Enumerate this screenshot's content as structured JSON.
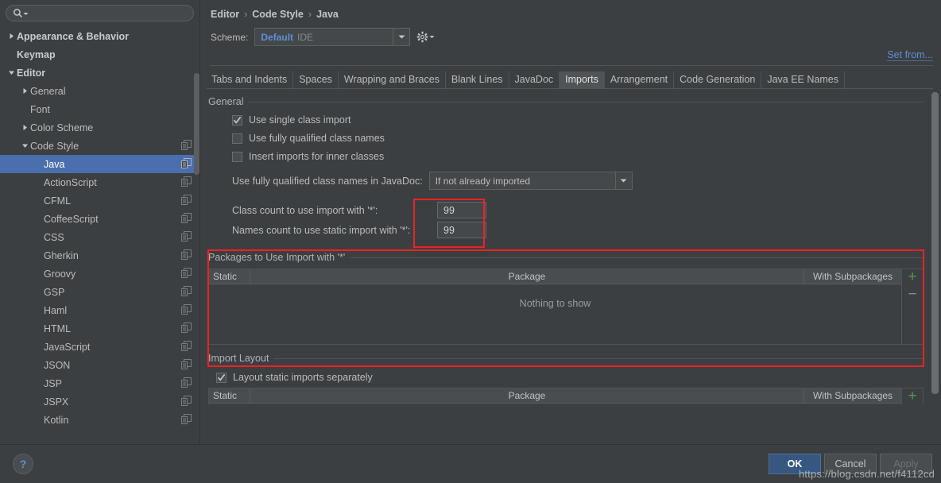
{
  "search": {
    "placeholder": "",
    "value": "",
    "icon": "search-icon"
  },
  "sidebar": {
    "items": [
      {
        "label": "Appearance & Behavior",
        "arrow": "collapsed",
        "indent": 0,
        "bold": true,
        "copy": false,
        "selected": false
      },
      {
        "label": "Keymap",
        "arrow": "none",
        "indent": 0,
        "bold": true,
        "copy": false,
        "selected": false
      },
      {
        "label": "Editor",
        "arrow": "expanded",
        "indent": 0,
        "bold": true,
        "copy": false,
        "selected": false
      },
      {
        "label": "General",
        "arrow": "collapsed",
        "indent": 1,
        "bold": false,
        "copy": false,
        "selected": false
      },
      {
        "label": "Font",
        "arrow": "none",
        "indent": 1,
        "bold": false,
        "copy": false,
        "selected": false
      },
      {
        "label": "Color Scheme",
        "arrow": "collapsed",
        "indent": 1,
        "bold": false,
        "copy": false,
        "selected": false
      },
      {
        "label": "Code Style",
        "arrow": "expanded",
        "indent": 1,
        "bold": false,
        "copy": true,
        "selected": false
      },
      {
        "label": "Java",
        "arrow": "none",
        "indent": 2,
        "bold": false,
        "copy": true,
        "selected": true
      },
      {
        "label": "ActionScript",
        "arrow": "none",
        "indent": 2,
        "bold": false,
        "copy": true,
        "selected": false
      },
      {
        "label": "CFML",
        "arrow": "none",
        "indent": 2,
        "bold": false,
        "copy": true,
        "selected": false
      },
      {
        "label": "CoffeeScript",
        "arrow": "none",
        "indent": 2,
        "bold": false,
        "copy": true,
        "selected": false
      },
      {
        "label": "CSS",
        "arrow": "none",
        "indent": 2,
        "bold": false,
        "copy": true,
        "selected": false
      },
      {
        "label": "Gherkin",
        "arrow": "none",
        "indent": 2,
        "bold": false,
        "copy": true,
        "selected": false
      },
      {
        "label": "Groovy",
        "arrow": "none",
        "indent": 2,
        "bold": false,
        "copy": true,
        "selected": false
      },
      {
        "label": "GSP",
        "arrow": "none",
        "indent": 2,
        "bold": false,
        "copy": true,
        "selected": false
      },
      {
        "label": "Haml",
        "arrow": "none",
        "indent": 2,
        "bold": false,
        "copy": true,
        "selected": false
      },
      {
        "label": "HTML",
        "arrow": "none",
        "indent": 2,
        "bold": false,
        "copy": true,
        "selected": false
      },
      {
        "label": "JavaScript",
        "arrow": "none",
        "indent": 2,
        "bold": false,
        "copy": true,
        "selected": false
      },
      {
        "label": "JSON",
        "arrow": "none",
        "indent": 2,
        "bold": false,
        "copy": true,
        "selected": false
      },
      {
        "label": "JSP",
        "arrow": "none",
        "indent": 2,
        "bold": false,
        "copy": true,
        "selected": false
      },
      {
        "label": "JSPX",
        "arrow": "none",
        "indent": 2,
        "bold": false,
        "copy": true,
        "selected": false
      },
      {
        "label": "Kotlin",
        "arrow": "none",
        "indent": 2,
        "bold": false,
        "copy": true,
        "selected": false
      }
    ]
  },
  "breadcrumb": {
    "parts": [
      "Editor",
      "Code Style",
      "Java"
    ],
    "separator": "›"
  },
  "scheme": {
    "label": "Scheme:",
    "value": "Default",
    "suffix": "IDE",
    "gear_icon": "gear-icon",
    "dropdown_icon": "chevron-down-icon"
  },
  "set_from": {
    "label": "Set from..."
  },
  "tabs": [
    {
      "label": "Tabs and Indents",
      "active": false
    },
    {
      "label": "Spaces",
      "active": false
    },
    {
      "label": "Wrapping and Braces",
      "active": false
    },
    {
      "label": "Blank Lines",
      "active": false
    },
    {
      "label": "JavaDoc",
      "active": false
    },
    {
      "label": "Imports",
      "active": true
    },
    {
      "label": "Arrangement",
      "active": false
    },
    {
      "label": "Code Generation",
      "active": false
    },
    {
      "label": "Java EE Names",
      "active": false
    }
  ],
  "general_group": {
    "title": "General",
    "checkboxes": [
      {
        "label": "Use single class import",
        "checked": true
      },
      {
        "label": "Use fully qualified class names",
        "checked": false
      },
      {
        "label": "Insert imports for inner classes",
        "checked": false
      }
    ],
    "javadoc": {
      "label": "Use fully qualified class names in JavaDoc:",
      "value": "If not already imported"
    },
    "class_count": {
      "label": "Class count to use import with '*':",
      "value": "99"
    },
    "names_count": {
      "label": "Names count to use static import with '*':",
      "value": "99"
    }
  },
  "packages_group": {
    "title": "Packages to Use Import with '*'",
    "columns": [
      "Static",
      "Package",
      "With Subpackages"
    ],
    "empty_text": "Nothing to show",
    "rows": [],
    "add_button": "+",
    "remove_button": "−"
  },
  "import_layout": {
    "title": "Import Layout",
    "checkbox": {
      "label": "Layout static imports separately",
      "checked": true
    },
    "columns": [
      "Static",
      "Package",
      "With Subpackages"
    ],
    "add_button": "+"
  },
  "footer": {
    "help_label": "?",
    "ok_label": "OK",
    "cancel_label": "Cancel",
    "apply_label": "Apply"
  },
  "watermark": {
    "text": "https://blog.csdn.net/f4112cd"
  },
  "colors": {
    "accent_blue": "#5a91d6",
    "selection_blue": "#4b6eaf",
    "annotation_red": "#ee2222",
    "add_green": "#499c54",
    "panel_bg": "#3c3f41",
    "ok_button": "#365880"
  }
}
